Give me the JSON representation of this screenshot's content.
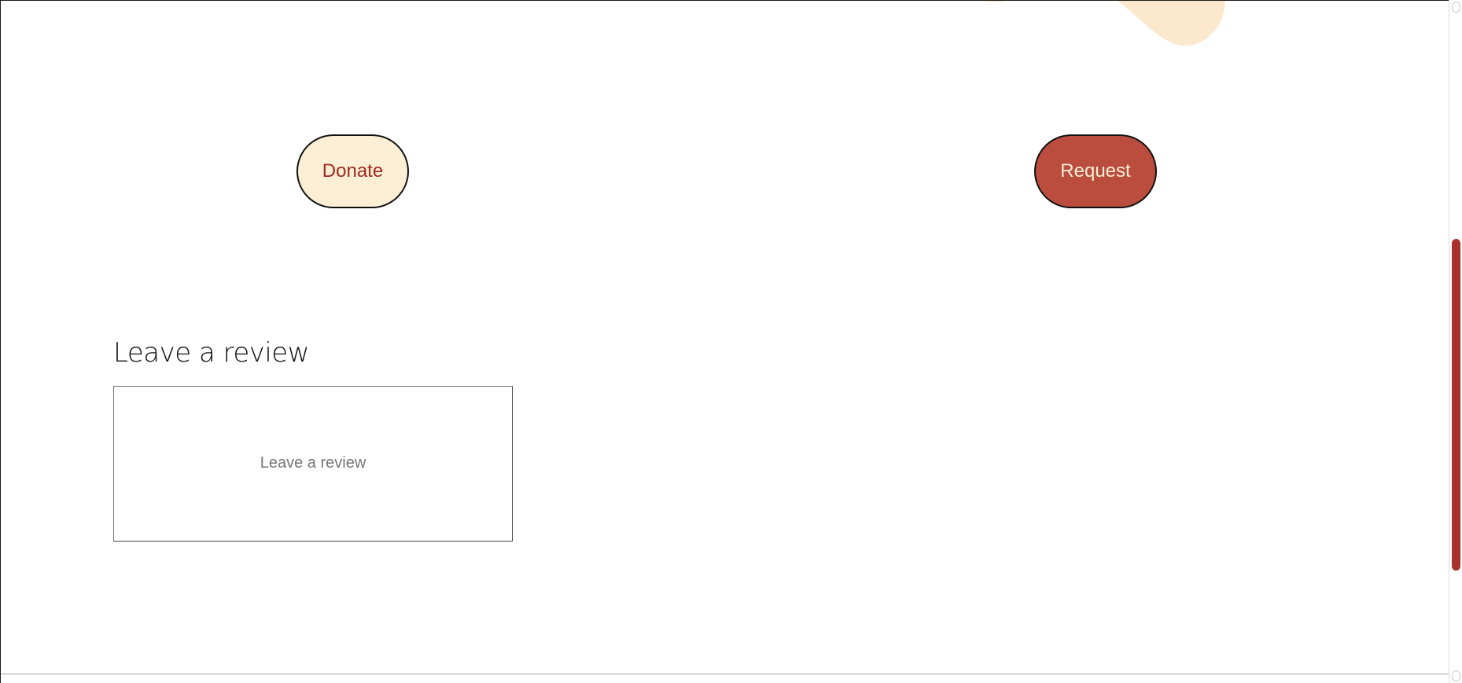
{
  "actions": {
    "donate_label": "Donate",
    "request_label": "Request"
  },
  "review": {
    "heading": "Leave a review",
    "placeholder": "Leave a review",
    "value": ""
  },
  "colors": {
    "donate_bg": "#fcefd5",
    "donate_text": "#a0291f",
    "request_bg": "#ba4d3d",
    "request_text": "#fcefd5",
    "accent_scrollbar": "#a8312c",
    "blob": "#fce8cc"
  }
}
